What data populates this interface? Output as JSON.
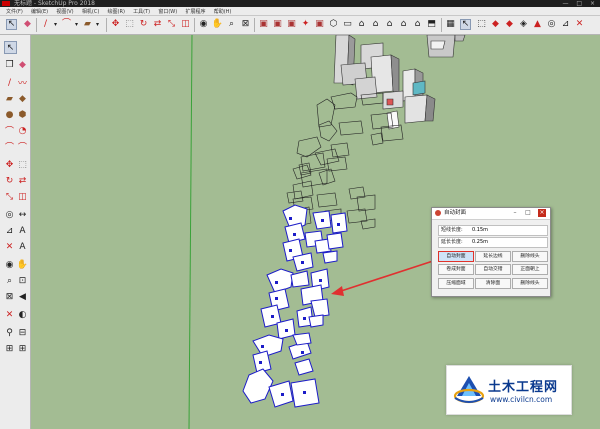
{
  "window": {
    "title": "无标题 - SketchUp Pro 2018",
    "controls": "— □ ×"
  },
  "menu": [
    "文件(F)",
    "编辑(E)",
    "视图(V)",
    "相机(C)",
    "绘图(R)",
    "工具(T)",
    "窗口(W)",
    "扩展程序",
    "帮助(H)"
  ],
  "dialog": {
    "title": "自动封面",
    "fields": [
      {
        "label": "短线长度:",
        "value": "0.15m"
      },
      {
        "label": "延长长度:",
        "value": "0.25m"
      }
    ],
    "buttons": [
      "自动封面",
      "延长边线",
      "删除线头",
      "卷成封面",
      "自动交错",
      "正面朝上",
      "压缩面域",
      "清除面",
      "删除线头"
    ]
  },
  "watermark": {
    "title": "土木工程网",
    "url": "www.civilcn.com"
  },
  "colors": {
    "canvas": "#a3bc93",
    "green_axis": "#3aa23a",
    "selected_outline": "#1c1cc8",
    "arrow": "#e03030"
  }
}
